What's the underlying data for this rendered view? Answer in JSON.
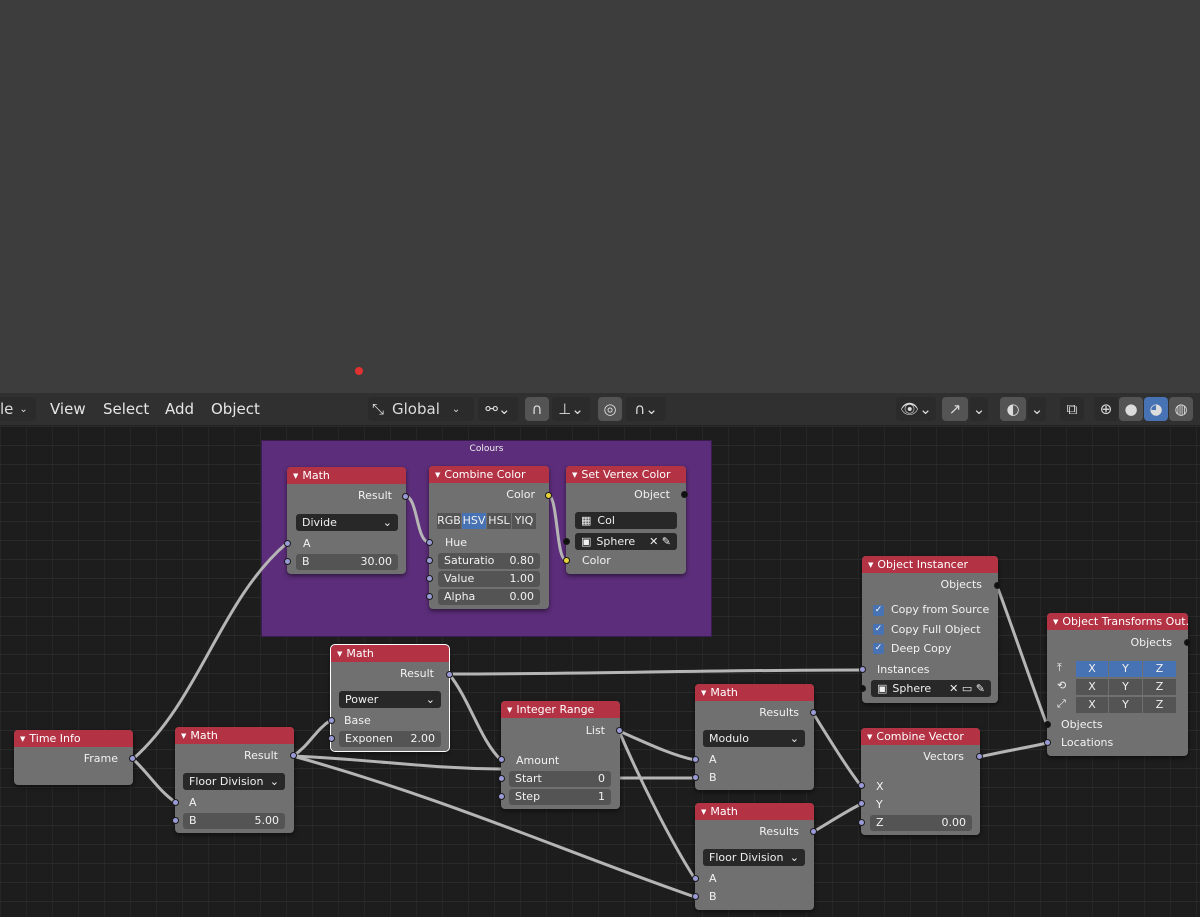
{
  "header": {
    "mode_label": "le",
    "menus": [
      "View",
      "Select",
      "Add",
      "Object"
    ],
    "transform_orientation": "Global"
  },
  "frame": {
    "label": "Colours"
  },
  "nodes": {
    "math_divide": {
      "title": "Math",
      "output": "Result",
      "operation": "Divide",
      "input_a": "A",
      "input_b_label": "B",
      "input_b_value": "30.00"
    },
    "combine_color": {
      "title": "Combine Color",
      "output": "Color",
      "modes": [
        "RGB",
        "HSV",
        "HSL",
        "YIQ"
      ],
      "active_mode": "HSV",
      "input_hue": "Hue",
      "saturation_label": "Saturatio",
      "saturation_value": "0.80",
      "value_label": "Value",
      "value_value": "1.00",
      "alpha_label": "Alpha",
      "alpha_value": "0.00"
    },
    "set_vertex_color": {
      "title": "Set Vertex Color",
      "output": "Object",
      "attribute": "Col",
      "object": "Sphere",
      "input_color": "Color"
    },
    "object_instancer": {
      "title": "Object Instancer",
      "output": "Objects",
      "copy_from_source": "Copy from Source",
      "copy_full_object": "Copy Full Object",
      "deep_copy": "Deep Copy",
      "input_instances": "Instances",
      "object": "Sphere"
    },
    "object_transforms_output": {
      "title": "Object Transforms Out..",
      "output": "Objects",
      "axes": [
        "X",
        "Y",
        "Z"
      ],
      "input_objects": "Objects",
      "input_locations": "Locations"
    },
    "math_power": {
      "title": "Math",
      "output": "Result",
      "operation": "Power",
      "input_base": "Base",
      "exponent_label": "Exponen",
      "exponent_value": "2.00"
    },
    "time_info": {
      "title": "Time Info",
      "output": "Frame"
    },
    "math_floor": {
      "title": "Math",
      "output": "Result",
      "operation": "Floor Division",
      "input_a": "A",
      "input_b_label": "B",
      "input_b_value": "5.00"
    },
    "integer_range": {
      "title": "Integer Range",
      "output": "List",
      "input_amount": "Amount",
      "start_label": "Start",
      "start_value": "0",
      "step_label": "Step",
      "step_value": "1"
    },
    "math_modulo": {
      "title": "Math",
      "output": "Results",
      "operation": "Modulo",
      "input_a": "A",
      "input_b": "B"
    },
    "math_floor2": {
      "title": "Math",
      "output": "Results",
      "operation": "Floor Division",
      "input_a": "A",
      "input_b": "B"
    },
    "combine_vector": {
      "title": "Combine Vector",
      "output": "Vectors",
      "input_x": "X",
      "input_y": "Y",
      "z_label": "Z",
      "z_value": "0.00"
    }
  },
  "colors": {
    "node_header": "#b33244",
    "frame": "#5c2d7a",
    "socket_number": "#9a9ad6",
    "socket_color": "#e8d43a",
    "accent": "#4772b3"
  }
}
